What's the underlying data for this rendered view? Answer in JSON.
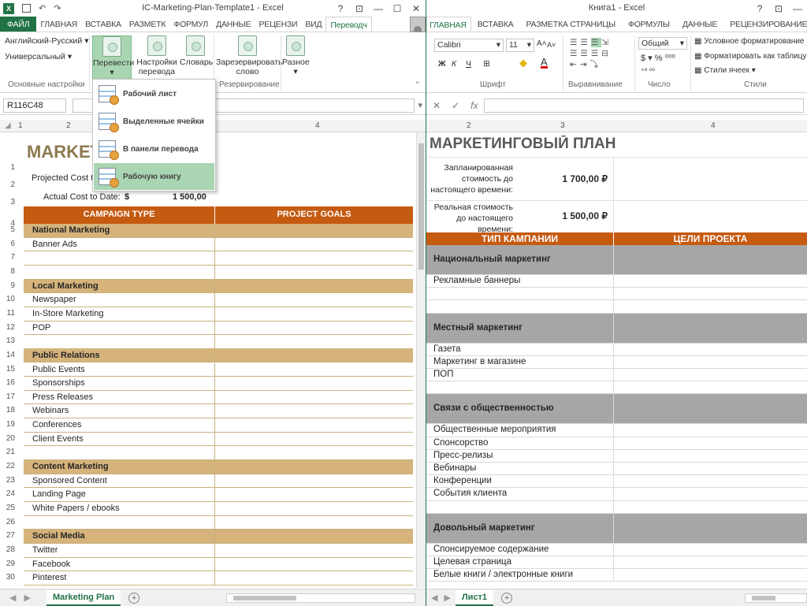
{
  "left": {
    "title": "IC-Marketing-Plan-Template1 - Excel",
    "controls": {
      "help": "?",
      "restore": "⊡",
      "minimize": "—",
      "maximize": "☐",
      "close": "✕"
    },
    "qa": {
      "undo": "↶",
      "redo": "↷"
    },
    "tabs": [
      "ФАЙЛ",
      "ГЛАВНАЯ",
      "ВСТАВКА",
      "РАЗМЕТК",
      "ФОРМУЛ",
      "ДАННЫЕ",
      "РЕЦЕНЗИ",
      "ВИД",
      "Переводч"
    ],
    "ribbon": {
      "lang_source": "Английский-Русский",
      "lang_mode": "Универсальный",
      "group_basic": "Основные настройки",
      "translate": "Перевести",
      "settings": "Настройки перевода",
      "dictionary": "Словарь",
      "reserve": "Зарезервировать слово",
      "misc": "Разное",
      "group_reserve": "Резервирование"
    },
    "namebox": "R116C48",
    "col_headers": [
      "1",
      "2",
      "4"
    ],
    "dropdown": [
      "Рабочий лист",
      "Выделенные ячейки",
      "В панели перевода",
      "Рабочую книгу"
    ],
    "sheet": {
      "title": "MARKET",
      "projected_label": "Projected Cost to",
      "actual_label": "Actual Cost to Date:",
      "currency": "$",
      "actual_value": "1 500,00",
      "header_type": "CAMPAIGN TYPE",
      "header_goals": "PROJECT GOALS",
      "rows": [
        {
          "n": "5",
          "text": "National Marketing",
          "kind": "cat"
        },
        {
          "n": "6",
          "text": "Banner Ads",
          "kind": "item"
        },
        {
          "n": "7",
          "text": "",
          "kind": "item"
        },
        {
          "n": "8",
          "text": "",
          "kind": "item"
        },
        {
          "n": "9",
          "text": "Local Marketing",
          "kind": "cat"
        },
        {
          "n": "10",
          "text": "Newspaper",
          "kind": "item"
        },
        {
          "n": "11",
          "text": "In-Store Marketing",
          "kind": "item"
        },
        {
          "n": "12",
          "text": "POP",
          "kind": "item"
        },
        {
          "n": "13",
          "text": "",
          "kind": "item"
        },
        {
          "n": "14",
          "text": "Public Relations",
          "kind": "cat"
        },
        {
          "n": "15",
          "text": "Public Events",
          "kind": "item"
        },
        {
          "n": "16",
          "text": "Sponsorships",
          "kind": "item"
        },
        {
          "n": "17",
          "text": "Press Releases",
          "kind": "item"
        },
        {
          "n": "18",
          "text": "Webinars",
          "kind": "item"
        },
        {
          "n": "19",
          "text": "Conferences",
          "kind": "item"
        },
        {
          "n": "20",
          "text": "Client Events",
          "kind": "item"
        },
        {
          "n": "21",
          "text": "",
          "kind": "item"
        },
        {
          "n": "22",
          "text": "Content Marketing",
          "kind": "cat"
        },
        {
          "n": "23",
          "text": "Sponsored Content",
          "kind": "item"
        },
        {
          "n": "24",
          "text": "Landing Page",
          "kind": "item"
        },
        {
          "n": "25",
          "text": "White Papers / ebooks",
          "kind": "item"
        },
        {
          "n": "26",
          "text": "",
          "kind": "item"
        },
        {
          "n": "27",
          "text": "Social Media",
          "kind": "cat"
        },
        {
          "n": "28",
          "text": "Twitter",
          "kind": "item"
        },
        {
          "n": "29",
          "text": "Facebook",
          "kind": "item"
        },
        {
          "n": "30",
          "text": "Pinterest",
          "kind": "item"
        }
      ]
    },
    "sheet_tab": "Marketing Plan",
    "add_sheet": "+"
  },
  "right": {
    "title": "Книга1 - Excel",
    "controls": {
      "help": "?",
      "restore": "⊡",
      "minimize": "—"
    },
    "tabs": [
      "ГЛАВНАЯ",
      "ВСТАВКА",
      "РАЗМЕТКА СТРАНИЦЫ",
      "ФОРМУЛЫ",
      "ДАННЫЕ",
      "РЕЦЕНЗИРОВАНИЕ"
    ],
    "ribbon": {
      "font": "Calibri",
      "size": "11",
      "number_format": "Общий",
      "cond_format": "Условное форматирование",
      "format_table": "Форматировать как таблицу",
      "cell_styles": "Стили ячеек",
      "group_font": "Шрифт",
      "group_align": "Выравнивание",
      "group_number": "Число",
      "group_styles": "Стили"
    },
    "col_headers": [
      "2",
      "3",
      "4"
    ],
    "sheet": {
      "title": "МАРКЕТИНГОВЫЙ ПЛАН",
      "planned_label": "Запланированная стоимость до настоящего времени:",
      "planned_value": "1 700,00 ₽",
      "actual_label": "Реальная стоимость до настоящего времени:",
      "actual_value": "1 500,00 ₽",
      "header_type": "ТИП КАМПАНИИ",
      "header_goals": "ЦЕЛИ ПРОЕКТА",
      "rows": [
        {
          "text": "Национальный маркетинг",
          "kind": "cat"
        },
        {
          "text": "Рекламные баннеры",
          "kind": "item"
        },
        {
          "text": "",
          "kind": "item"
        },
        {
          "text": "",
          "kind": "item"
        },
        {
          "text": "Местный маркетинг",
          "kind": "cat"
        },
        {
          "text": "Газета",
          "kind": "item"
        },
        {
          "text": "Маркетинг в магазине",
          "kind": "item"
        },
        {
          "text": "ПОП",
          "kind": "item"
        },
        {
          "text": "",
          "kind": "item"
        },
        {
          "text": "Связи с общественностью",
          "kind": "cat"
        },
        {
          "text": "Общественные мероприятия",
          "kind": "item"
        },
        {
          "text": "Спонсорство",
          "kind": "item"
        },
        {
          "text": "Пресс-релизы",
          "kind": "item"
        },
        {
          "text": "Вебинары",
          "kind": "item"
        },
        {
          "text": "Конференции",
          "kind": "item"
        },
        {
          "text": "События клиента",
          "kind": "item"
        },
        {
          "text": "",
          "kind": "item"
        },
        {
          "text": "Довольный маркетинг",
          "kind": "cat"
        },
        {
          "text": "Спонсируемое содержание",
          "kind": "item"
        },
        {
          "text": "Целевая страница",
          "kind": "item"
        },
        {
          "text": "Белые книги / электронные книги",
          "kind": "item"
        }
      ]
    },
    "sheet_tab": "Лист1",
    "add_sheet": "+"
  },
  "colors": {
    "excel_green": "#217346",
    "header_orange": "#c55a11",
    "category_tan": "#d5b37b",
    "category_gray": "#a6a6a6",
    "pressed_green": "#a9d5b3"
  }
}
